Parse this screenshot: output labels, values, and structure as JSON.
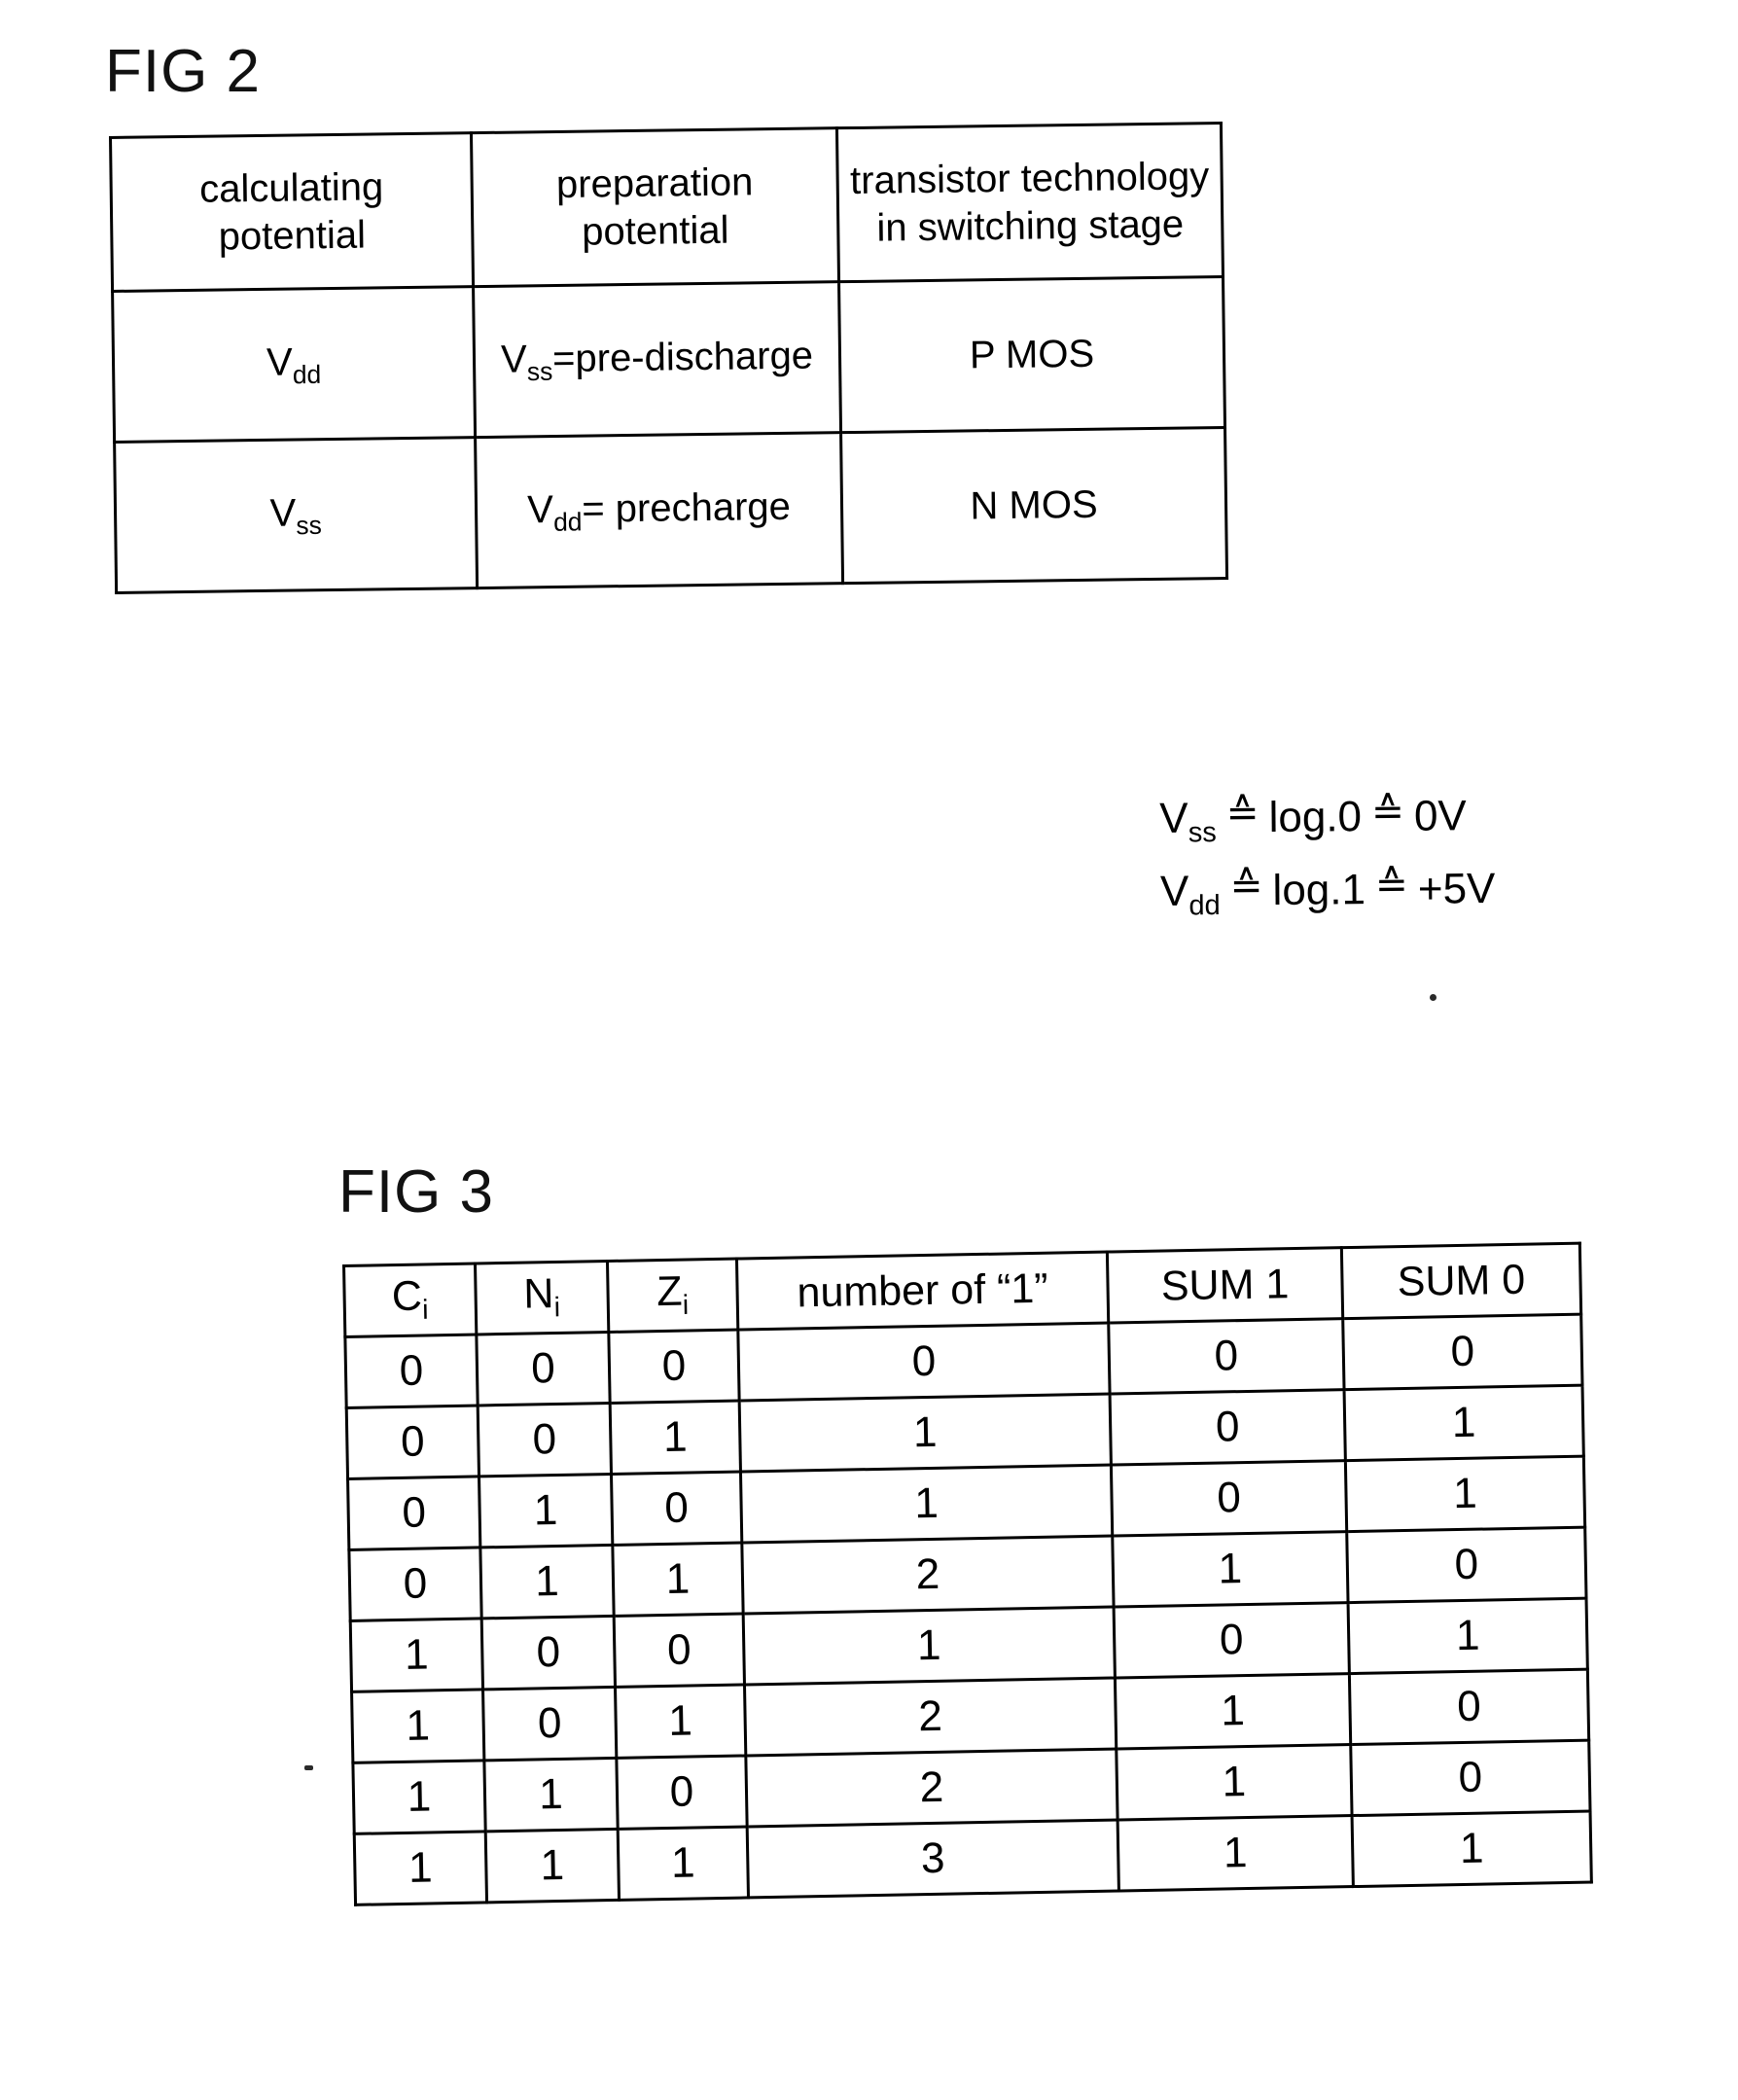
{
  "figures": [
    {
      "id": "fig2",
      "label": "FIG 2",
      "table": {
        "headers": [
          "calculating potential",
          "preparation potential",
          "transistor technology in switching stage"
        ],
        "header_lines": [
          [
            "calculating",
            "potential"
          ],
          [
            "preparation",
            "potential"
          ],
          [
            "transistor technology",
            "in switching stage"
          ]
        ],
        "rows": [
          {
            "calculating_potential": {
              "base": "V",
              "sub": "dd",
              "suffix": ""
            },
            "preparation_potential": {
              "base": "V",
              "sub": "ss",
              "suffix": "=pre-discharge"
            },
            "transistor_technology": "P MOS"
          },
          {
            "calculating_potential": {
              "base": "V",
              "sub": "ss",
              "suffix": ""
            },
            "preparation_potential": {
              "base": "V",
              "sub": "dd",
              "suffix": "= precharge"
            },
            "transistor_technology": "N MOS"
          }
        ]
      },
      "legend": [
        {
          "symbol_base": "V",
          "symbol_sub": "ss",
          "rel1": "≙",
          "logic": "log.0",
          "rel2": "≙",
          "voltage": "0V"
        },
        {
          "symbol_base": "V",
          "symbol_sub": "dd",
          "rel1": "≙",
          "logic": "log.1",
          "rel2": "≙",
          "voltage": "+5V"
        }
      ]
    },
    {
      "id": "fig3",
      "label": "FIG 3",
      "table": {
        "headers": [
          {
            "base": "C",
            "sub": "i"
          },
          {
            "base": "N",
            "sub": "i"
          },
          {
            "base": "Z",
            "sub": "i"
          },
          {
            "base": "number of “1”",
            "sub": ""
          },
          {
            "base": "SUM 1",
            "sub": ""
          },
          {
            "base": "SUM 0",
            "sub": ""
          }
        ],
        "rows": [
          [
            "0",
            "0",
            "0",
            "0",
            "0",
            "0"
          ],
          [
            "0",
            "0",
            "1",
            "1",
            "0",
            "1"
          ],
          [
            "0",
            "1",
            "0",
            "1",
            "0",
            "1"
          ],
          [
            "0",
            "1",
            "1",
            "2",
            "1",
            "0"
          ],
          [
            "1",
            "0",
            "0",
            "1",
            "0",
            "1"
          ],
          [
            "1",
            "0",
            "1",
            "2",
            "1",
            "0"
          ],
          [
            "1",
            "1",
            "0",
            "2",
            "1",
            "0"
          ],
          [
            "1",
            "1",
            "1",
            "3",
            "1",
            "1"
          ]
        ]
      }
    }
  ],
  "colors": {
    "ink": "#000000",
    "paper": "#ffffff"
  }
}
